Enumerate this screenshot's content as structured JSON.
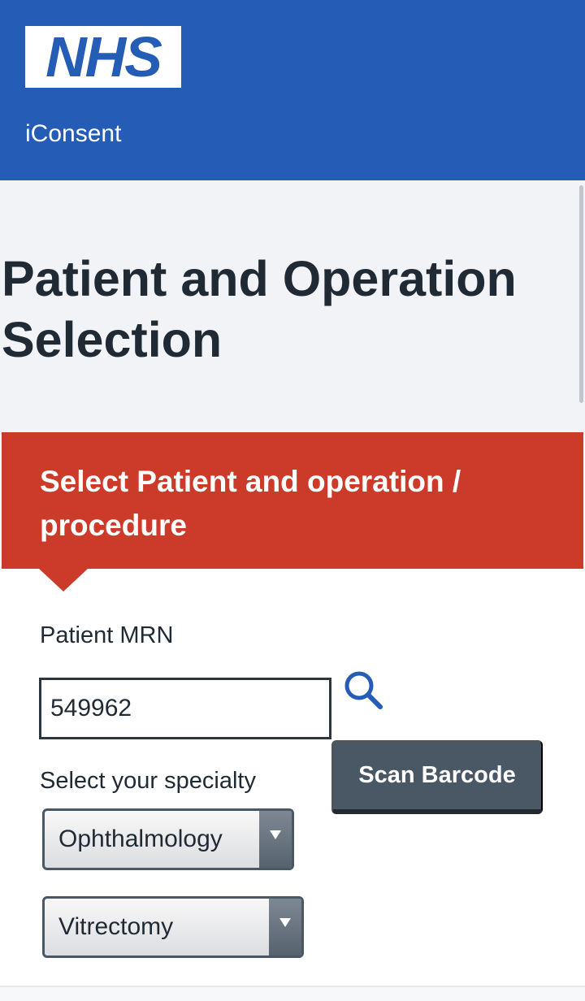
{
  "header": {
    "logo_text": "NHS",
    "app_name": "iConsent",
    "brand_color": "#255cb6"
  },
  "page": {
    "title_line1": "Patient and Operation",
    "title_line2": "Selection"
  },
  "section": {
    "heading_line1": "Select Patient and operation /",
    "heading_line2": "procedure",
    "accent_color": "#cc3b2a"
  },
  "form": {
    "mrn_label": "Patient MRN",
    "mrn_value": "549962",
    "search_icon": "search-icon",
    "scan_button_label": "Scan Barcode",
    "specialty_label": "Select your specialty",
    "specialty_selected": "Ophthalmology",
    "procedure_selected": "Vitrectomy"
  }
}
